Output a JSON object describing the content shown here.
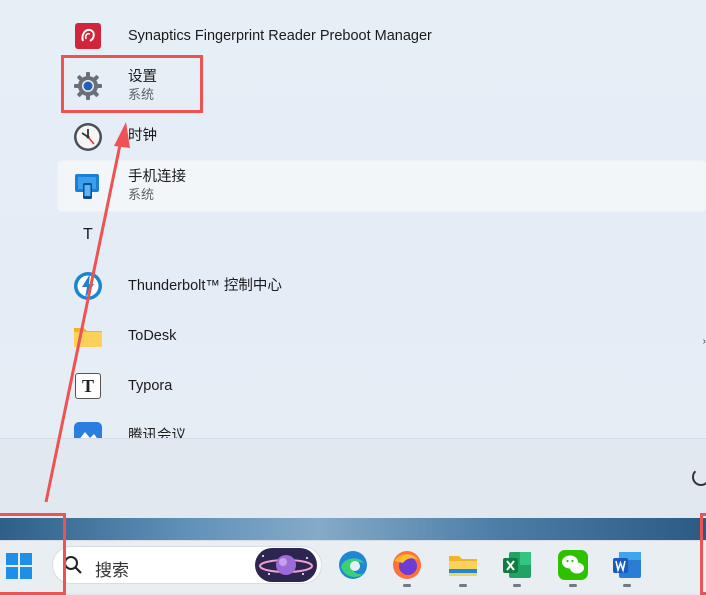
{
  "apps": [
    {
      "name": "Synaptics Fingerprint Reader Preboot Manager",
      "sub": "",
      "icon": "synaptics-icon"
    },
    {
      "name": "设置",
      "sub": "系统",
      "icon": "settings-gear-icon"
    },
    {
      "name": "时钟",
      "sub": "",
      "icon": "clock-icon"
    },
    {
      "name": "手机连接",
      "sub": "系统",
      "icon": "phone-link-icon"
    },
    {
      "name": "Thunderbolt™ 控制中心",
      "sub": "",
      "icon": "thunderbolt-icon"
    },
    {
      "name": "ToDesk",
      "sub": "",
      "icon": "folder-icon"
    },
    {
      "name": "Typora",
      "sub": "",
      "icon": "typora-icon"
    },
    {
      "name": "腾讯会议",
      "sub": "",
      "icon": "tencent-meeting-icon"
    }
  ],
  "letter_header": "T",
  "typora_letter": "T",
  "search": {
    "placeholder": "搜索"
  },
  "taskbar_icons": [
    "edge-icon",
    "firefox-icon",
    "file-explorer-icon",
    "excel-icon",
    "wechat-icon",
    "word-icon"
  ],
  "annotation": {
    "highlight_color": "#ee5253"
  }
}
